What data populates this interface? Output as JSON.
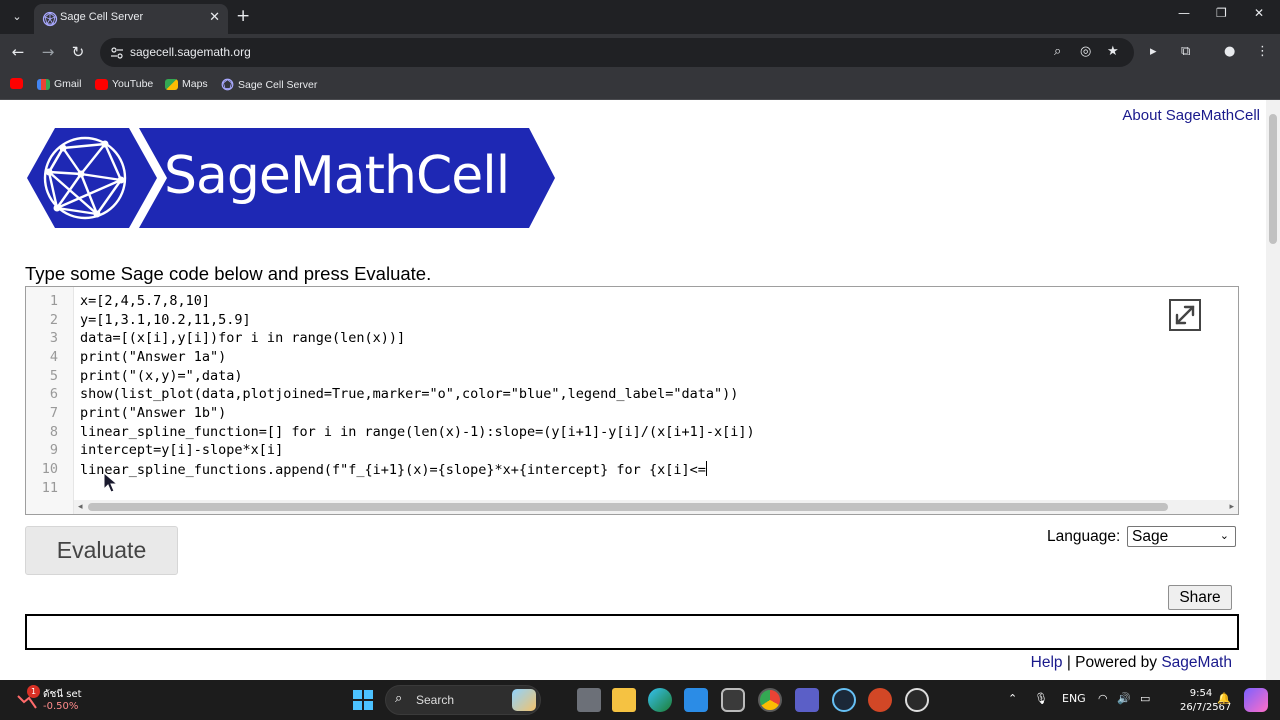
{
  "browser": {
    "tab_title": "Sage Cell Server",
    "url": "sagecell.sagemath.org",
    "bookmarks": [
      "Gmail",
      "YouTube",
      "Maps",
      "Sage Cell Server"
    ]
  },
  "page": {
    "about_link": "About SageMathCell",
    "logo_text": "SageMathCell",
    "instructions": "Type some Sage code below and press Evaluate.",
    "code_lines": [
      {
        "n": "1",
        "text": "x=[2,4,5.7,8,10]"
      },
      {
        "n": "2",
        "text": "y=[1,3.1,10.2,11,5.9]"
      },
      {
        "n": "3",
        "text": "data=[(x[i],y[i])for i in range(len(x))]"
      },
      {
        "n": "4",
        "text": "print(\"Answer 1a\")"
      },
      {
        "n": "5",
        "text": "print(\"(x,y)=\",data)"
      },
      {
        "n": "6",
        "text": "show(list_plot(data,plotjoined=True,marker=\"o\",color=\"blue\",legend_label=\"data\"))"
      },
      {
        "n": "7",
        "text": "print(\"Answer 1b\")"
      },
      {
        "n": "8",
        "text": "linear_spline_function=[] for i in range(len(x)-1):slope=(y[i+1]-y[i]/(x[i+1]-x[i])"
      },
      {
        "n": "9",
        "text": "intercept=y[i]-slope*x[i]"
      },
      {
        "n": "10",
        "text": "linear_spline_functions.append(f\"f_{i+1}(x)={slope}*x+{intercept} for {x[i]<="
      },
      {
        "n": "11",
        "text": ""
      }
    ],
    "evaluate_label": "Evaluate",
    "language_label": "Language:",
    "language_value": "Sage",
    "share_label": "Share",
    "footer": {
      "help": "Help",
      "separator": " | Powered by ",
      "sagemath": "SageMath"
    }
  },
  "taskbar": {
    "widget_name": "ดัชนี set",
    "widget_badge": "1",
    "widget_value": "-0.50%",
    "search_label": "Search",
    "language": "ENG",
    "time": "9:54",
    "date": "26/7/2567"
  },
  "colors": {
    "sage_blue": "#1e28b4",
    "link": "#1a1a8c"
  }
}
